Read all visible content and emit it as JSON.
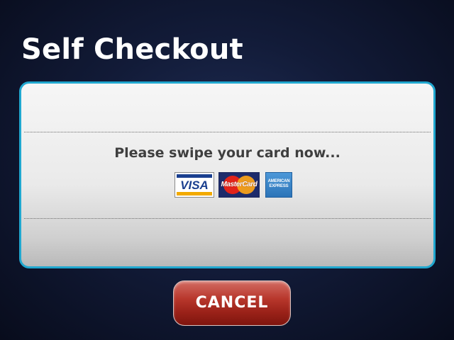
{
  "header": {
    "title": "Self Checkout"
  },
  "panel": {
    "message": "Please swipe your card now...",
    "accepted_cards": [
      {
        "name": "visa-logo",
        "label": "VISA"
      },
      {
        "name": "mastercard-logo",
        "label": "MasterCard"
      },
      {
        "name": "american-express-logo",
        "label": "AMERICAN EXPRESS"
      }
    ]
  },
  "actions": {
    "cancel_label": "CANCEL"
  },
  "colors": {
    "panel_border": "#20a7cf",
    "cancel_button": "#9b2219",
    "background": "#121b38"
  }
}
